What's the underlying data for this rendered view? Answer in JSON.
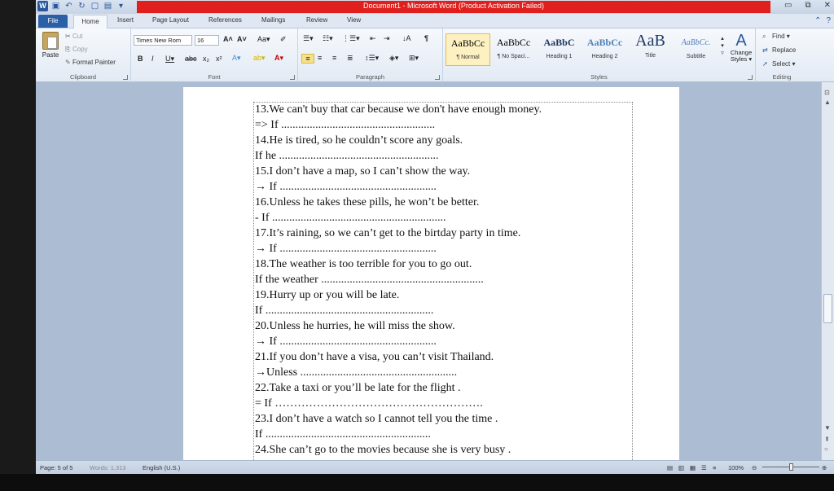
{
  "window": {
    "title": "Document1  -  Microsoft Word (Product Activation Failed)",
    "controls": [
      "▭",
      "⧉",
      "✕"
    ]
  },
  "tabs": [
    "File",
    "Home",
    "Insert",
    "Page Layout",
    "References",
    "Mailings",
    "Review",
    "View"
  ],
  "ribbon": {
    "clipboard": {
      "paste": "Paste",
      "cut": "Cut",
      "copy": "Copy",
      "format_painter": "Format Painter",
      "label": "Clipboard"
    },
    "font": {
      "name": "Times New Rom",
      "size": "16",
      "label": "Font"
    },
    "paragraph": {
      "label": "Paragraph"
    },
    "styles": {
      "label": "Styles",
      "items": [
        {
          "sample": "AaBbCc",
          "name": "¶ Normal"
        },
        {
          "sample": "AaBbCc",
          "name": "¶ No Spaci..."
        },
        {
          "sample": "AaBbC",
          "name": "Heading 1"
        },
        {
          "sample": "AaBbCc",
          "name": "Heading 2"
        },
        {
          "sample": "AaB",
          "name": "Title"
        },
        {
          "sample": "AaBbCc.",
          "name": "Subtitle"
        }
      ],
      "change_styles": "Change Styles ▾"
    },
    "editing": {
      "find": "Find ▾",
      "replace": "Replace",
      "select": "Select ▾",
      "label": "Editing"
    }
  },
  "document": {
    "lines": [
      "13.We can't buy that car because we don't have enough money.",
      "=> If  ......................................................",
      "14.He is tired, so he couldn’t score any goals.",
      "If he ........................................................",
      "15.I don’t have a map, so I can’t show the way.",
      "→ If .......................................................",
      "16.Unless he takes these pills, he won’t be better.",
      "- If .............................................................",
      "17.It’s raining, so we can’t get to the birtday party in time.",
      "→ If .......................................................",
      "18.The weather is too terrible for you to go out.",
      "If the weather .........................................................",
      "19.Hurry up or you will be late.",
      "If ...........................................................",
      "20.Unless he hurries, he will miss the show.",
      "→ If .......................................................",
      "21.If you don’t have a visa, you can’t visit Thailand.",
      "→Unless .......................................................",
      "22.Take a taxi or you’ll be late for the flight .",
      "= If ……………………………………………….",
      "23.I don’t have a watch so I cannot tell you the time .",
      "If ..........................................................",
      "24.She can’t go to the movies because she is very busy ."
    ]
  },
  "status": {
    "page": "Page: 5 of 5",
    "words": "Words: 1,313",
    "language": "English (U.S.)",
    "zoom": "100%"
  }
}
